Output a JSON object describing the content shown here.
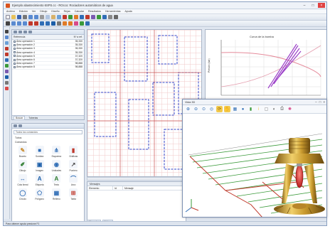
{
  "window": {
    "title": "Ejemplo abastecimiento 6SPS.cc - ROcco: Rociadores automáticos de agua"
  },
  "menu": [
    "Archivo",
    "Edición",
    "Ver",
    "Dibujo",
    "Diseño",
    "Rejas",
    "Calcular",
    "Resultados",
    "Herramientas",
    "Ayuda"
  ],
  "references": {
    "col_ref": "Referencia",
    "col_value": "Nº a ref.",
    "rows": [
      {
        "label": "Área operación 1",
        "value": "35,330"
      },
      {
        "label": "Área operación 2",
        "value": "35,330"
      },
      {
        "label": "Área operación 3",
        "value": "35,330"
      },
      {
        "label": "Área operación 4",
        "value": "35,330"
      },
      {
        "label": "Área operación 5",
        "value": "37,320"
      },
      {
        "label": "Área operación 6",
        "value": "37,320"
      },
      {
        "label": "Área operación 7",
        "value": "98,888"
      },
      {
        "label": "Área operación 8",
        "value": "98,888"
      }
    ],
    "tabs": [
      "Buscar",
      "Tuberías"
    ]
  },
  "components": {
    "search_placeholder": "Todos los comandos",
    "category": "Tubos",
    "subcategory": "Comandos",
    "items": [
      {
        "label": "Boceto",
        "icon": "pencil-icon",
        "glyph": "✎",
        "color": "#c98a2a"
      },
      {
        "label": "Sombra",
        "icon": "square-icon",
        "glyph": "■",
        "color": "#2f6db5"
      },
      {
        "label": "Esquema",
        "icon": "network-icon",
        "glyph": "⋔",
        "color": "#2f6db5"
      },
      {
        "label": "Gráficas",
        "icon": "chart-icon",
        "glyph": "▮",
        "color": "#c0392b"
      },
      {
        "label": "Dibujo",
        "icon": "brush-icon",
        "glyph": "✐",
        "color": "#2a7a2a"
      },
      {
        "label": "Imagen",
        "icon": "image-icon",
        "glyph": "▣",
        "color": "#1b5ea8"
      },
      {
        "label": "Unidades",
        "icon": "units-icon",
        "glyph": "◉",
        "color": "#2f6db5"
      },
      {
        "label": "Puntero",
        "icon": "pointer-icon",
        "glyph": "↗",
        "color": "#444444"
      },
      {
        "label": "Cota lineal",
        "icon": "dimension-icon",
        "glyph": "↔",
        "color": "#2f6db5"
      },
      {
        "label": "Etiqueta",
        "icon": "text-icon",
        "glyph": "A",
        "color": "#1b5ea8"
      },
      {
        "label": "Texto",
        "icon": "text-a-icon",
        "glyph": "A",
        "color": "#2a7a2a"
      },
      {
        "label": "Arco",
        "icon": "arc-icon",
        "glyph": "⌒",
        "color": "#2f6db5"
      },
      {
        "label": "Círculo",
        "icon": "circle-icon",
        "glyph": "◯",
        "color": "#2f6db5"
      },
      {
        "label": "Polígono",
        "icon": "polygon-icon",
        "glyph": "⬠",
        "color": "#2f6db5"
      },
      {
        "label": "Relleno",
        "icon": "hatch-icon",
        "glyph": "▦",
        "color": "#2f6db5"
      },
      {
        "label": "Tabla",
        "icon": "table-icon",
        "glyph": "⊞",
        "color": "#c0392b"
      }
    ]
  },
  "chart": {
    "title": "Curva de la bomba",
    "ylabel": "Presión (bar)"
  },
  "messages": {
    "title": "Mensajes",
    "columns": [
      "Elemento",
      "Id",
      "Mensaje"
    ],
    "tabs": [
      "Mensajes",
      "Notas"
    ]
  },
  "view3d": {
    "title": "Vista 3D"
  },
  "status": {
    "text": "Para obtener ayuda presione F1"
  },
  "colors": {
    "accent": "#2f6db5",
    "pipe_red": "#c0392b",
    "pipe_green": "#3a9a3a",
    "sprinkler_gold": "#c99a2e"
  }
}
